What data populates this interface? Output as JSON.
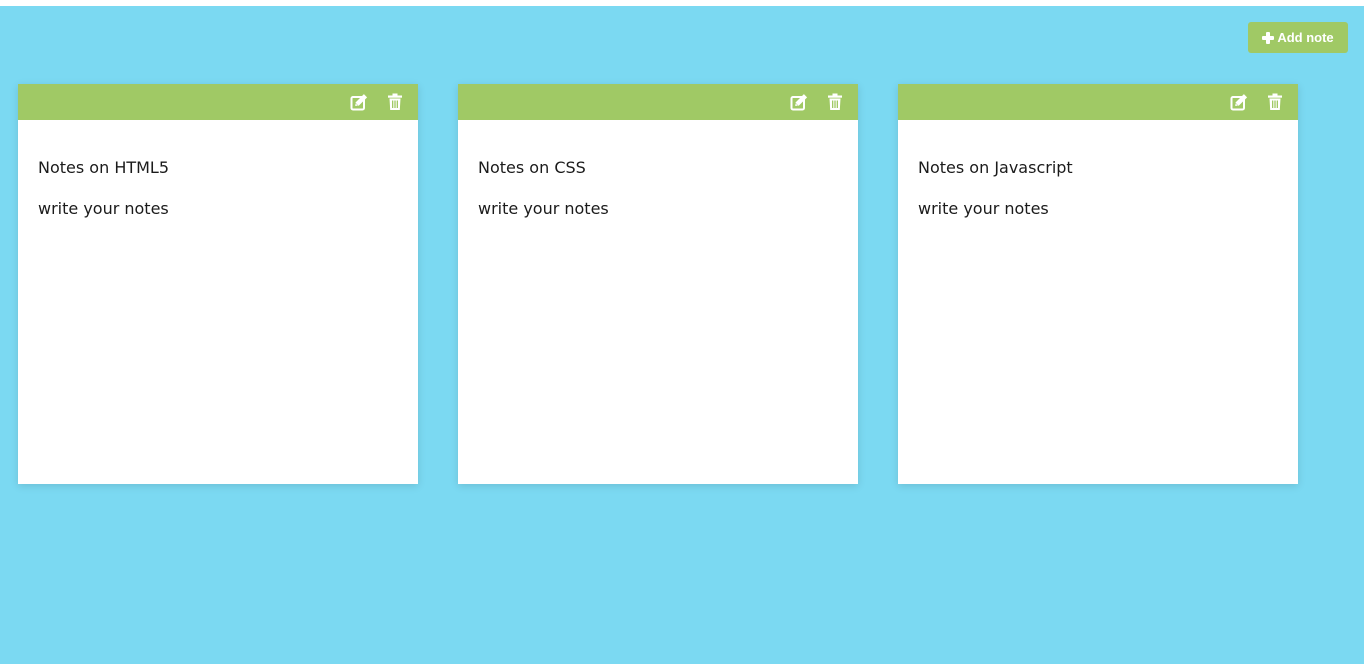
{
  "toolbar": {
    "add_label": "Add note",
    "add_icon": "plus-icon"
  },
  "colors": {
    "background": "#7bd9f2",
    "accent": "#a0c965",
    "card": "#ffffff",
    "text": "#1b1b1b"
  },
  "notes": [
    {
      "title": "Notes on HTML5",
      "body": "write your notes",
      "edit_icon": "edit-icon",
      "delete_icon": "trash-icon"
    },
    {
      "title": "Notes on CSS",
      "body": "write your notes",
      "edit_icon": "edit-icon",
      "delete_icon": "trash-icon"
    },
    {
      "title": "Notes on Javascript",
      "body": "write your notes",
      "edit_icon": "edit-icon",
      "delete_icon": "trash-icon"
    }
  ]
}
